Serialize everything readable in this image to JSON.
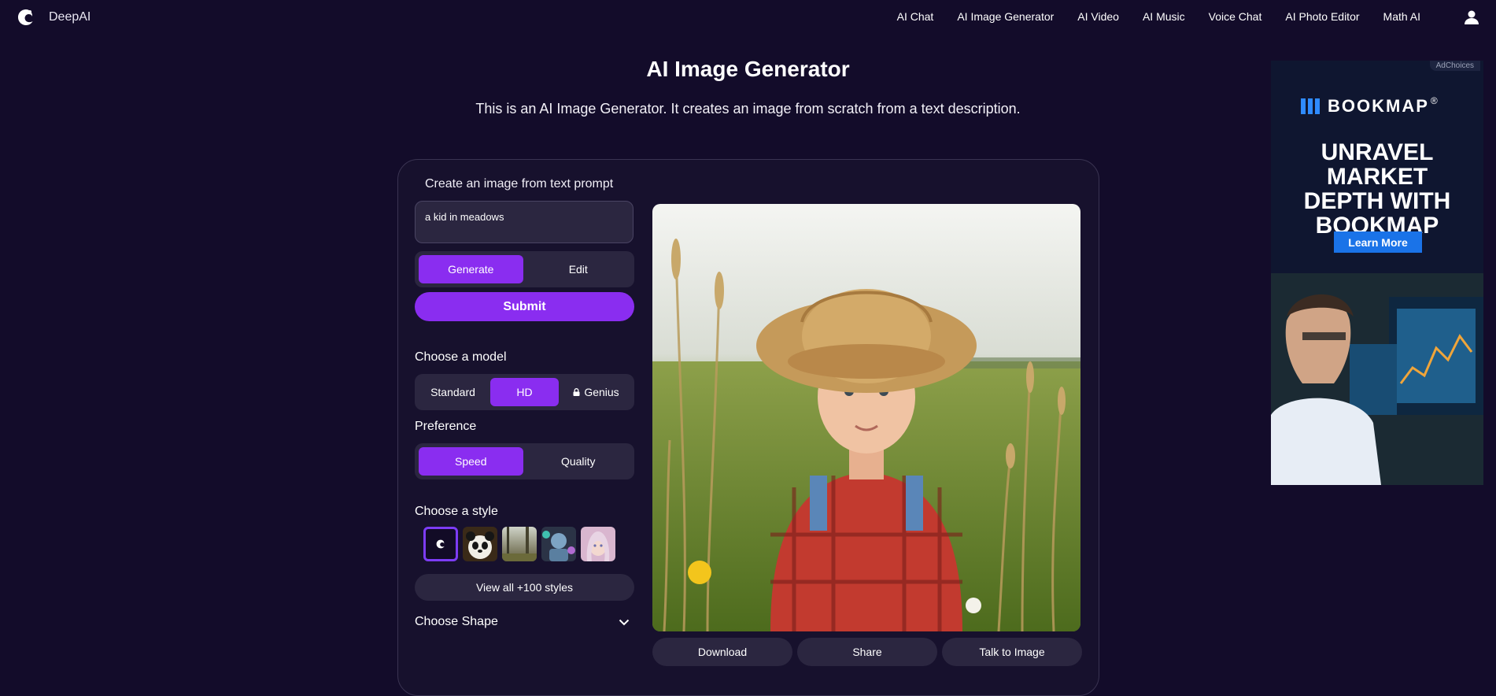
{
  "header": {
    "brand": "DeepAI",
    "nav": [
      "AI Chat",
      "AI Image Generator",
      "AI Video",
      "AI Music",
      "Voice Chat",
      "AI Photo Editor",
      "Math AI"
    ]
  },
  "hero": {
    "title": "AI Image Generator",
    "subtitle": "This is an AI Image Generator. It creates an image from scratch from a text description."
  },
  "generator": {
    "heading": "Create an image from text prompt",
    "prompt_value": "a kid in meadows",
    "mode": {
      "generate": "Generate",
      "edit": "Edit",
      "active": "Generate"
    },
    "submit": "Submit",
    "model_label": "Choose a model",
    "models": {
      "standard": "Standard",
      "hd": "HD",
      "genius": "Genius",
      "active": "HD"
    },
    "preference_label": "Preference",
    "preference": {
      "speed": "Speed",
      "quality": "Quality",
      "active": "Speed"
    },
    "style_label": "Choose a style",
    "styles": [
      "default",
      "panda",
      "forest",
      "robot",
      "fantasy-girl"
    ],
    "view_all": "View all +100 styles",
    "shape_label": "Choose Shape"
  },
  "actions": {
    "download": "Download",
    "share": "Share",
    "talk": "Talk to Image"
  },
  "ad": {
    "adchoices": "AdChoices",
    "brand": "BOOKMAP",
    "registered": "®",
    "headline_1": "UNRAVEL MARKET",
    "headline_2": "DEPTH WITH",
    "headline_3": "BOOKMAP",
    "cta": "Learn More"
  },
  "colors": {
    "accent": "#8a2df0",
    "background": "#130c2a",
    "panel": "#2b2640"
  }
}
